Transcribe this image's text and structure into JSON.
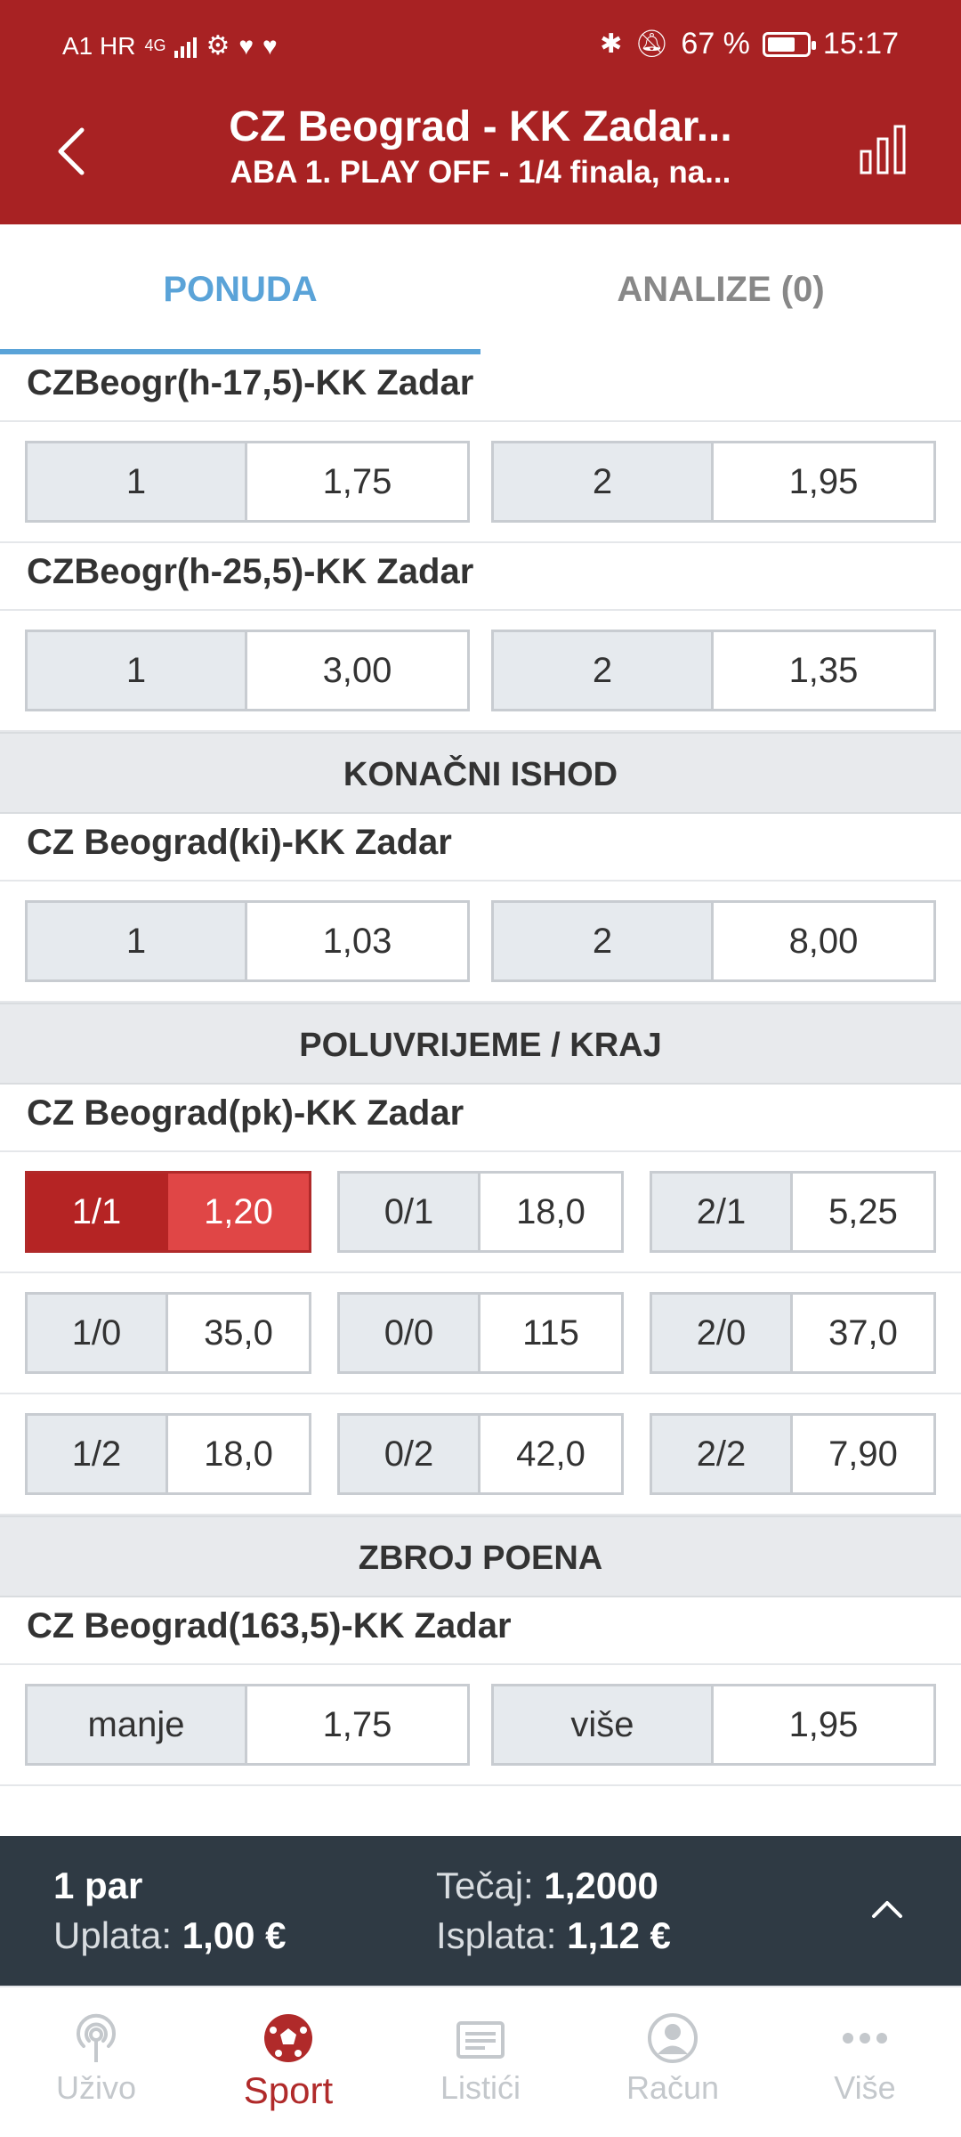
{
  "status_bar": {
    "carrier": "A1 HR",
    "network": "4G",
    "battery": "67 %",
    "time": "15:17"
  },
  "header": {
    "title": "CZ Beograd - KK Zadar...",
    "subtitle": "ABA 1. PLAY OFF - 1/4 finala, na..."
  },
  "tabs": [
    {
      "label": "PONUDA",
      "active": true
    },
    {
      "label": "ANALIZE (0)",
      "active": false
    }
  ],
  "markets": {
    "handicap1": {
      "title": "CZBeogr(h-17,5)-KK Zadar",
      "outcomes": [
        {
          "label": "1",
          "odd": "1,75"
        },
        {
          "label": "2",
          "odd": "1,95"
        }
      ]
    },
    "handicap2": {
      "title": "CZBeogr(h-25,5)-KK Zadar",
      "outcomes": [
        {
          "label": "1",
          "odd": "3,00"
        },
        {
          "label": "2",
          "odd": "1,35"
        }
      ]
    },
    "final_section": "KONAČNI ISHOD",
    "final": {
      "title": "CZ Beograd(ki)-KK Zadar",
      "outcomes": [
        {
          "label": "1",
          "odd": "1,03"
        },
        {
          "label": "2",
          "odd": "8,00"
        }
      ]
    },
    "htft_section": "POLUVRIJEME / KRAJ",
    "htft": {
      "title": "CZ Beograd(pk)-KK Zadar",
      "rows": [
        [
          {
            "label": "1/1",
            "odd": "1,20"
          },
          {
            "label": "0/1",
            "odd": "18,0"
          },
          {
            "label": "2/1",
            "odd": "5,25"
          }
        ],
        [
          {
            "label": "1/0",
            "odd": "35,0"
          },
          {
            "label": "0/0",
            "odd": "115"
          },
          {
            "label": "2/0",
            "odd": "37,0"
          }
        ],
        [
          {
            "label": "1/2",
            "odd": "18,0"
          },
          {
            "label": "0/2",
            "odd": "42,0"
          },
          {
            "label": "2/2",
            "odd": "7,90"
          }
        ]
      ]
    },
    "total_section": "ZBROJ POENA",
    "total": {
      "title": "CZ Beograd(163,5)-KK Zadar",
      "outcomes": [
        {
          "label": "manje",
          "odd": "1,75"
        },
        {
          "label": "više",
          "odd": "1,95"
        }
      ]
    }
  },
  "bet_slip": {
    "pairs": "1 par",
    "stake_label": "Uplata:",
    "stake": "1,00 €",
    "odds_label": "Tečaj:",
    "odds": "1,2000",
    "payout_label": "Isplata:",
    "payout": "1,12 €"
  },
  "bottom_nav": [
    {
      "label": "Uživo",
      "icon": "live-broadcast-icon"
    },
    {
      "label": "Sport",
      "icon": "soccer-ball-icon",
      "active": true
    },
    {
      "label": "Listići",
      "icon": "tickets-icon"
    },
    {
      "label": "Račun",
      "icon": "account-icon"
    },
    {
      "label": "Više",
      "icon": "more-dots-icon"
    }
  ],
  "colors": {
    "header": "#a82223",
    "accent_tab": "#5aa3d8",
    "selected_label": "#b52424",
    "selected_odd": "#e04646",
    "slip_bg": "#2f3a44"
  }
}
